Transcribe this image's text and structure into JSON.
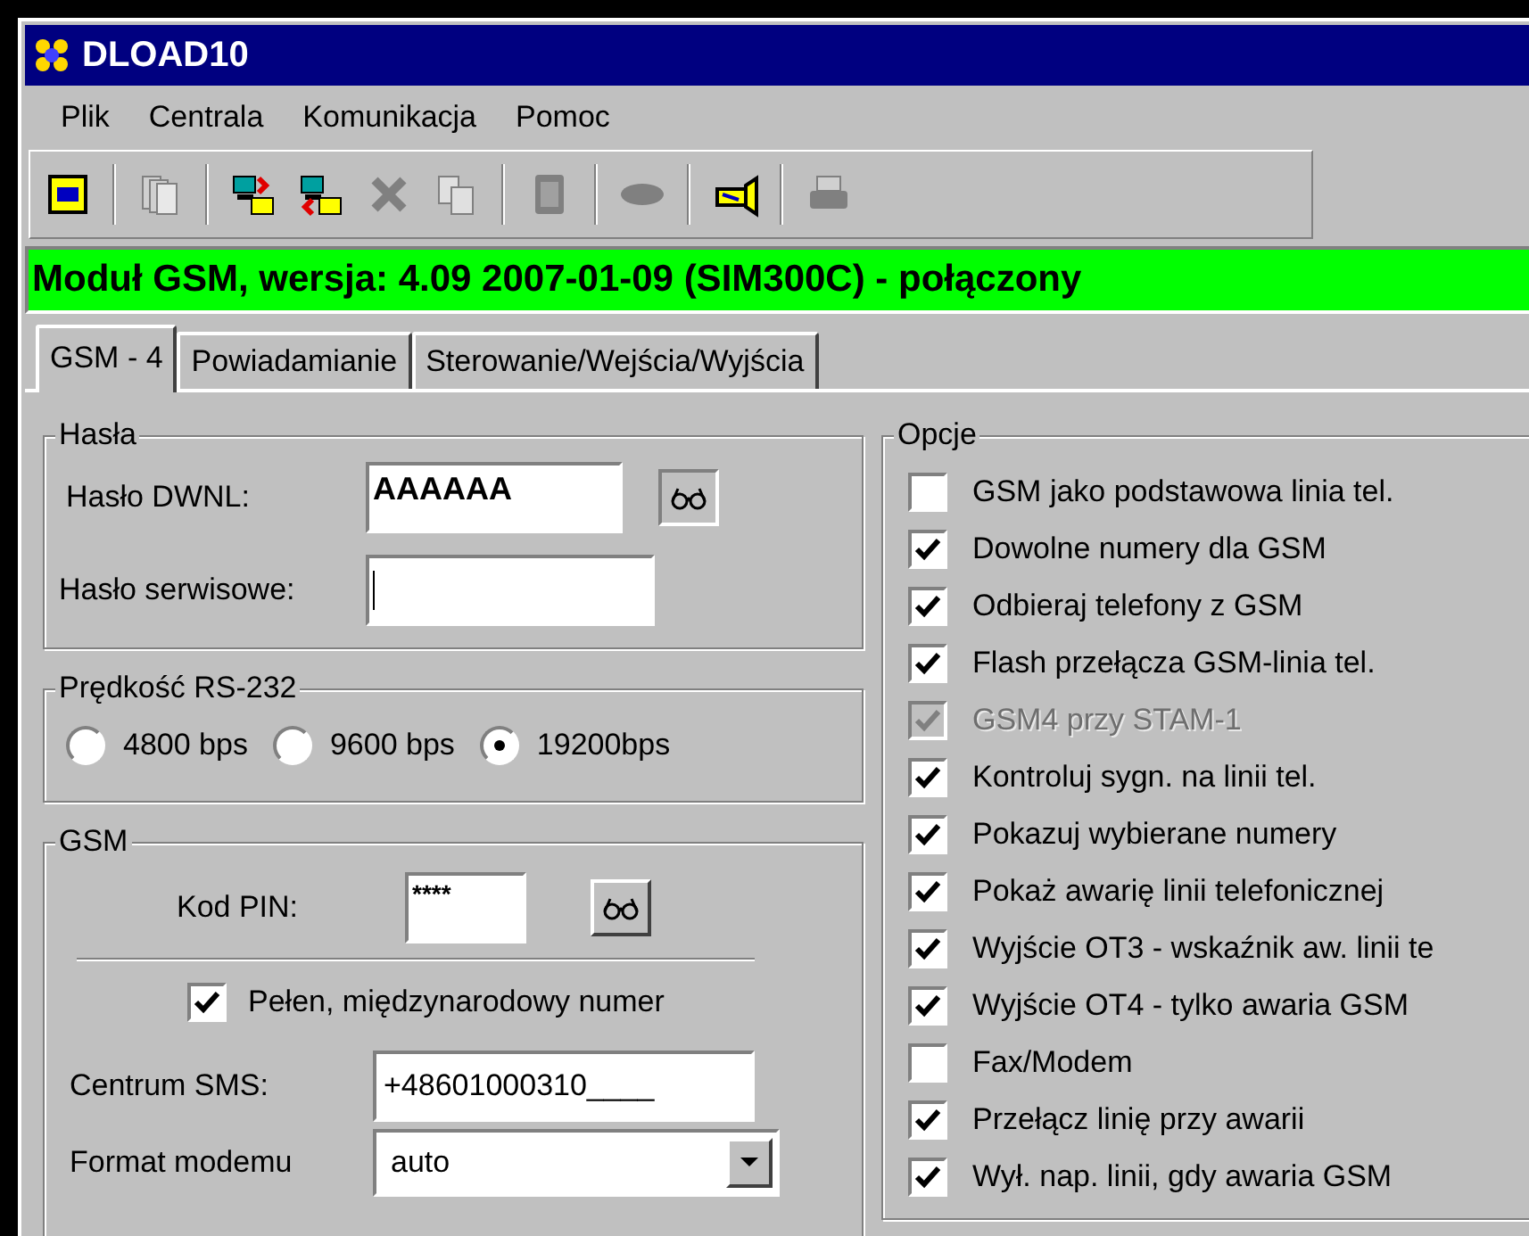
{
  "window": {
    "title": "DLOAD10"
  },
  "menu": [
    "Plik",
    "Centrala",
    "Komunikacja",
    "Pomoc"
  ],
  "toolbar": [
    {
      "kind": "card",
      "disabled": false
    },
    {
      "kind": "separator"
    },
    {
      "kind": "pages",
      "disabled": true
    },
    {
      "kind": "separator"
    },
    {
      "kind": "connect",
      "disabled": false
    },
    {
      "kind": "disconnect",
      "disabled": false
    },
    {
      "kind": "delete",
      "disabled": true
    },
    {
      "kind": "copy",
      "disabled": true
    },
    {
      "kind": "separator"
    },
    {
      "kind": "keypad",
      "disabled": true
    },
    {
      "kind": "separator"
    },
    {
      "kind": "oval",
      "disabled": true
    },
    {
      "kind": "separator"
    },
    {
      "kind": "horn",
      "disabled": false
    },
    {
      "kind": "separator"
    },
    {
      "kind": "printer",
      "disabled": true
    }
  ],
  "status": "Moduł GSM, wersja: 4.09 2007-01-09 (SIM300C) -  połączony",
  "tabs": [
    {
      "label": "GSM - 4",
      "selected": true
    },
    {
      "label": "Powiadamianie",
      "selected": false
    },
    {
      "label": "Sterowanie/Wejścia/Wyjścia",
      "selected": false
    }
  ],
  "passwords": {
    "title": "Hasła",
    "dwnl_label": "Hasło DWNL:",
    "dwnl_value": "AAAAAA",
    "service_label": "Hasło serwisowe:"
  },
  "speed": {
    "title": "Prędkość RS-232",
    "options": [
      {
        "label": "4800 bps",
        "selected": false
      },
      {
        "label": "9600 bps",
        "selected": false
      },
      {
        "label": "19200bps",
        "selected": true
      }
    ]
  },
  "gsm": {
    "title": "GSM",
    "pin_label": "Kod PIN:",
    "pin_value": "****",
    "full_number": {
      "label": "Pełen, międzynarodowy numer",
      "checked": true
    },
    "sms_label": "Centrum SMS:",
    "sms_value": "+48601000310____",
    "modem_label": "Format modemu",
    "modem_value": "auto"
  },
  "options": {
    "title": "Opcje",
    "items": [
      {
        "label": "GSM jako podstawowa linia tel.",
        "checked": false,
        "disabled": false
      },
      {
        "label": "Dowolne numery dla GSM",
        "checked": true,
        "disabled": false
      },
      {
        "label": "Odbieraj telefony z GSM",
        "checked": true,
        "disabled": false
      },
      {
        "label": "Flash przełącza  GSM-linia tel.",
        "checked": true,
        "disabled": false
      },
      {
        "label": "GSM4 przy STAM-1",
        "checked": true,
        "disabled": true
      },
      {
        "label": "Kontroluj sygn. na linii tel.",
        "checked": true,
        "disabled": false
      },
      {
        "label": "Pokazuj wybierane numery",
        "checked": true,
        "disabled": false
      },
      {
        "label": "Pokaż awarię linii telefonicznej",
        "checked": true,
        "disabled": false
      },
      {
        "label": "Wyjście OT3 - wskaźnik aw. linii te",
        "checked": true,
        "disabled": false
      },
      {
        "label": "Wyjście OT4 - tylko awaria GSM",
        "checked": true,
        "disabled": false
      },
      {
        "label": "Fax/Modem",
        "checked": false,
        "disabled": false
      },
      {
        "label": "Przełącz linię przy awarii",
        "checked": true,
        "disabled": false
      },
      {
        "label": "Wył. nap. linii, gdy awaria GSM",
        "checked": true,
        "disabled": false
      }
    ]
  }
}
